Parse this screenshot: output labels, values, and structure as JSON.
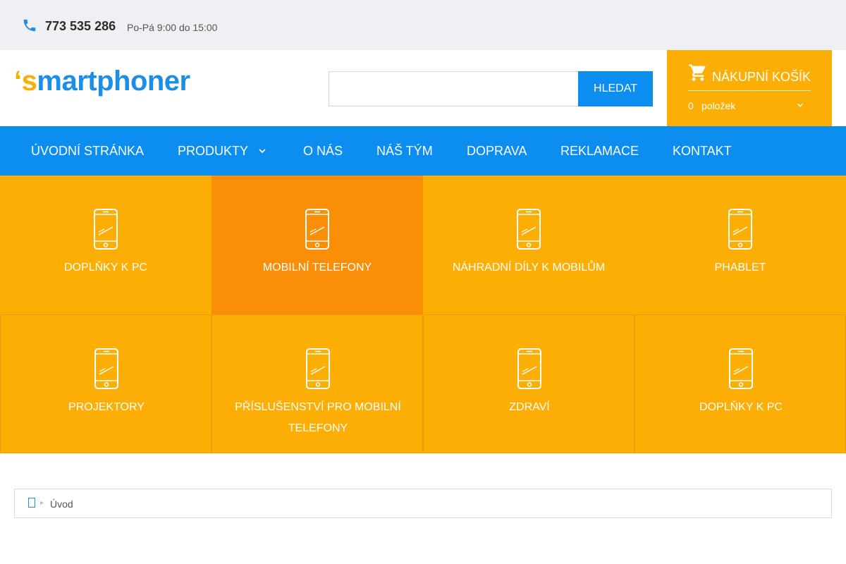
{
  "topbar": {
    "phone": "773 535 286",
    "hours": "Po-Pá 9:00 do 15:00",
    "icon": "phone-icon"
  },
  "header": {
    "logo": {
      "tick": "‘",
      "first": "s",
      "rest": "martphoner"
    },
    "search": {
      "value": "",
      "button_label": "HLEDAT"
    },
    "cart": {
      "title": "NÁKUPNÍ KOŠÍK",
      "count": "0",
      "items_label": "položek"
    }
  },
  "nav": {
    "items": [
      {
        "label": "ÚVODNÍ STRÁNKA"
      },
      {
        "label": "PRODUKTY"
      },
      {
        "label": "O NÁS"
      },
      {
        "label": "NÁŠ TÝM"
      },
      {
        "label": "DOPRAVA"
      },
      {
        "label": "REKLAMACE"
      },
      {
        "label": "KONTAKT"
      }
    ]
  },
  "categories": [
    {
      "label": "DOPLŇKY K PC",
      "active": false
    },
    {
      "label": "MOBILNÍ TELEFONY",
      "active": true
    },
    {
      "label": "NÁHRADNÍ DÍLY K MOBILŮM",
      "active": false
    },
    {
      "label": "PHABLET",
      "active": false
    },
    {
      "label": "PROJEKTORY",
      "active": false
    },
    {
      "label": "PŘÍSLUŠENSTVÍ PRO MOBILNÍ TELEFONY",
      "active": false
    },
    {
      "label": "ZDRAVÍ",
      "active": false
    },
    {
      "label": "DOPLŇKY K PC",
      "active": false
    }
  ],
  "breadcrumb": {
    "current": "Úvod"
  },
  "colors": {
    "accent_blue": "#0c8ef0",
    "accent_orange": "#fcae05",
    "active_orange": "#fa8e06",
    "topbar_bg": "#eff0f4"
  }
}
